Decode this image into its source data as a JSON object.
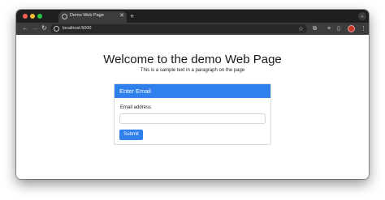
{
  "browser": {
    "tab": {
      "title": "Demo Web Page",
      "close_icon": "close-icon",
      "favicon": "globe-icon"
    },
    "new_tab_icon": "plus-icon",
    "address_bar": {
      "url": "localhost:5000",
      "site_info_icon": "info-icon",
      "bookmark_icon": "star-icon"
    },
    "toolbar_icons": [
      "back-icon",
      "forward-icon",
      "reload-icon",
      "extensions-icon",
      "media-icon",
      "side-panel-icon",
      "profile-avatar",
      "menu-icon"
    ]
  },
  "page": {
    "heading": "Welcome to the demo Web Page",
    "paragraph": "This is a sample text in a paragraph on the page",
    "form": {
      "header": "Enter Email",
      "email_label": "Email address",
      "email_value": "",
      "email_placeholder": "",
      "submit_label": "Submit"
    }
  },
  "colors": {
    "primary": "#2f80ed",
    "chrome_dark": "#1f1f1f",
    "toolbar": "#3c3c3c"
  }
}
